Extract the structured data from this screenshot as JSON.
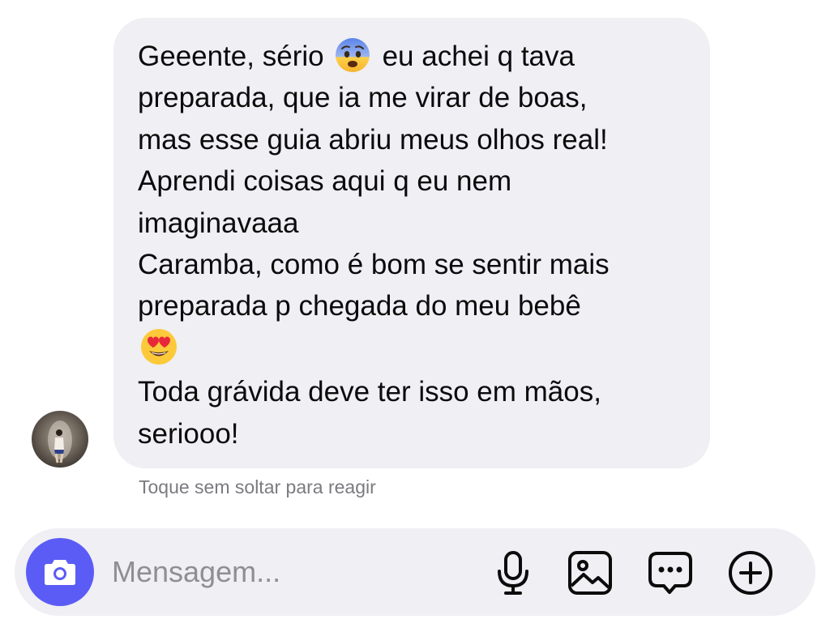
{
  "message": {
    "lines": [
      "Geeente, sério",
      "eu achei q tava",
      "preparada, que ia me virar de boas,",
      "mas esse guia abriu meus olhos real!",
      "Aprendi coisas aqui q eu nem",
      "imaginavaaa",
      "Caramba, como é bom se sentir mais",
      "preparada p chegada do meu bebê",
      "Toda grávida deve ter isso em mãos,",
      "seriooo!"
    ],
    "emojis": [
      "fearful-face-emoji",
      "heart-eyes-emoji"
    ]
  },
  "sender": {
    "avatar": "avatar-photo"
  },
  "hint": "Toque sem soltar para reagir",
  "composer": {
    "placeholder": "Mensagem...",
    "icons": [
      "camera-icon",
      "microphone-icon",
      "image-icon",
      "sticker-message-icon",
      "plus-circle-icon"
    ]
  },
  "colors": {
    "bubble": "#efeff4",
    "accent": "#5b5cf6",
    "hint_text": "#7a7a80",
    "placeholder": "#8e8e93"
  }
}
